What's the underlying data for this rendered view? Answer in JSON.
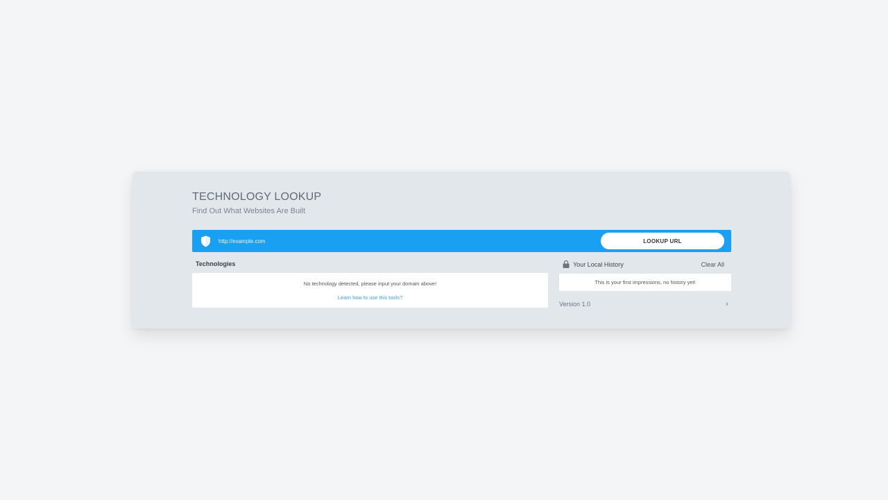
{
  "header": {
    "title": "TECHNOLOGY LOOKUP",
    "subtitle": "Find Out What Websites Are Built"
  },
  "lookup": {
    "placeholder": "http://example.com",
    "value": "",
    "button_label": "LOOKUP URL",
    "bar_color": "#1aa0f2",
    "icon": "shield-icon"
  },
  "technologies": {
    "heading": "Technologies",
    "empty_message": "No technology detected, please input your domain above!",
    "help_link": "Learn how to use this tools?"
  },
  "history": {
    "heading": "Your Local History",
    "clear_label": "Clear All",
    "empty_message": "This is your first impressions, no history yet!",
    "icon": "lock-icon"
  },
  "footer": {
    "version": "Version 1.0",
    "chevron": "›"
  }
}
